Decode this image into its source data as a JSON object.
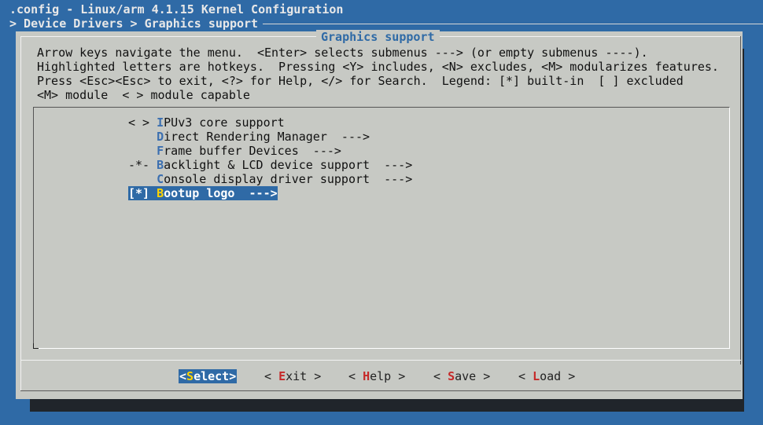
{
  "window": {
    "title": ".config - Linux/arm 4.1.15 Kernel Configuration",
    "breadcrumb": "> Device Drivers > Graphics support"
  },
  "dialog": {
    "title": "Graphics support",
    "help_lines": [
      "Arrow keys navigate the menu.  <Enter> selects submenus ---> (or empty submenus ----).",
      "Highlighted letters are hotkeys.  Pressing <Y> includes, <N> excludes, <M> modularizes features.",
      "Press <Esc><Esc> to exit, <?> for Help, </> for Search.  Legend: [*] built-in  [ ] excluded",
      "<M> module  < > module capable"
    ]
  },
  "menu": {
    "items": [
      {
        "prefix": "< > ",
        "hotkey": "I",
        "rest": "PUv3 core support",
        "selected": false
      },
      {
        "prefix": "    ",
        "hotkey": "D",
        "rest": "irect Rendering Manager  --->",
        "selected": false
      },
      {
        "prefix": "    ",
        "hotkey": "F",
        "rest": "rame buffer Devices  --->",
        "selected": false
      },
      {
        "prefix": "-*- ",
        "hotkey": "B",
        "rest": "acklight & LCD device support  --->",
        "selected": false
      },
      {
        "prefix": "    ",
        "hotkey": "C",
        "rest": "onsole display driver support  --->",
        "selected": false
      },
      {
        "prefix": "[*] ",
        "hotkey": "B",
        "rest": "ootup logo  --->",
        "selected": true
      }
    ]
  },
  "buttons": {
    "select": {
      "open": "<",
      "hotkey": "S",
      "rest": "elect>"
    },
    "exit": {
      "open": "< ",
      "hotkey": "E",
      "rest": "xit >"
    },
    "help": {
      "open": "< ",
      "hotkey": "H",
      "rest": "elp >"
    },
    "save": {
      "open": "< ",
      "hotkey": "S",
      "rest": "ave >"
    },
    "load": {
      "open": "< ",
      "hotkey": "L",
      "rest": "oad >"
    }
  },
  "colors": {
    "background": "#2f6aa6",
    "dialog": "#c7c9c4",
    "selection": "#2f6aa6",
    "hotkey": "#3b6fb0",
    "button_hotkey": "#c62828"
  }
}
